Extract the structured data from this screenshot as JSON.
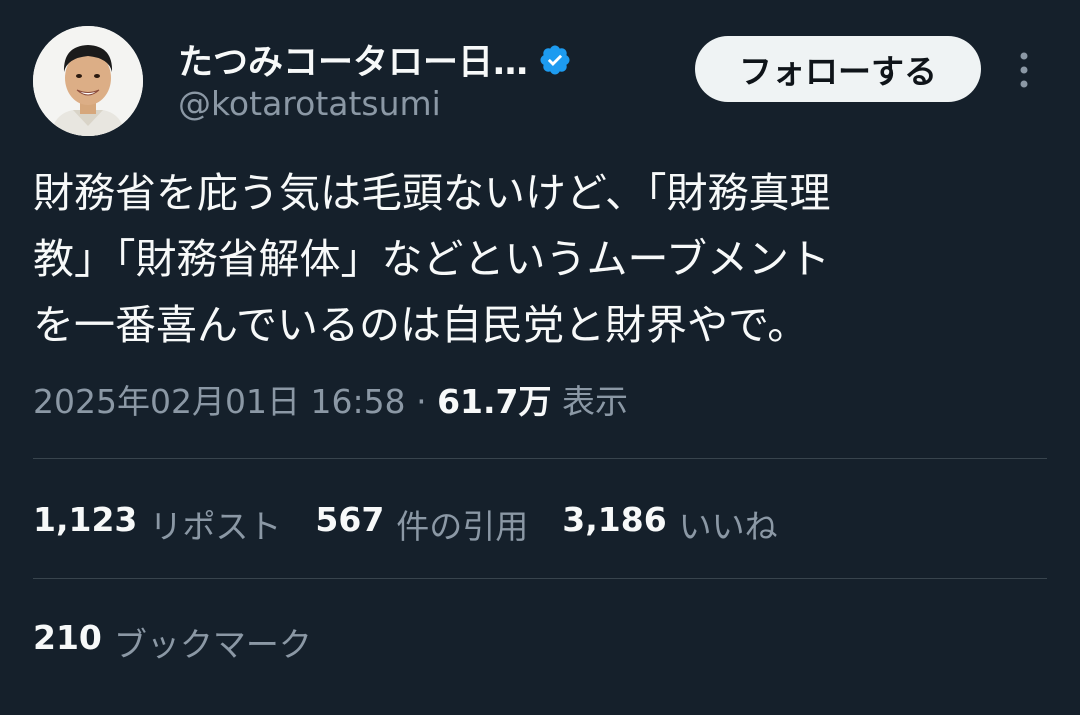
{
  "author": {
    "display_name": "たつみコータロー日…",
    "handle": "@kotarotatsumi",
    "verified": true
  },
  "follow_button": {
    "label": "フォローする"
  },
  "tweet": {
    "lines": [
      "財務省を庇う気は毛頭ないけど、「財務真理",
      "教」「財務省解体」などというムーブメント",
      "を一番喜んでいるのは自民党と財界やで。"
    ]
  },
  "meta": {
    "timestamp": "2025年02月01日 16:58",
    "separator": "·",
    "views_count": "61.7万",
    "views_label": "表示"
  },
  "stats": {
    "reposts": {
      "count": "1,123",
      "label": "リポスト"
    },
    "quotes": {
      "count": "567",
      "label": "件の引用"
    },
    "likes": {
      "count": "3,186",
      "label": "いいね"
    }
  },
  "bookmarks": {
    "count": "210",
    "label": "ブックマーク"
  },
  "colors": {
    "background": "#15202b",
    "text": "#f7f9f9",
    "secondary_text": "#8b98a5",
    "verified_badge": "#1d9bf0",
    "divider": "#38444d",
    "follow_button_bg": "#eff3f4"
  },
  "icons": {
    "verified": "verified-badge-icon",
    "more": "more-vertical-icon"
  }
}
